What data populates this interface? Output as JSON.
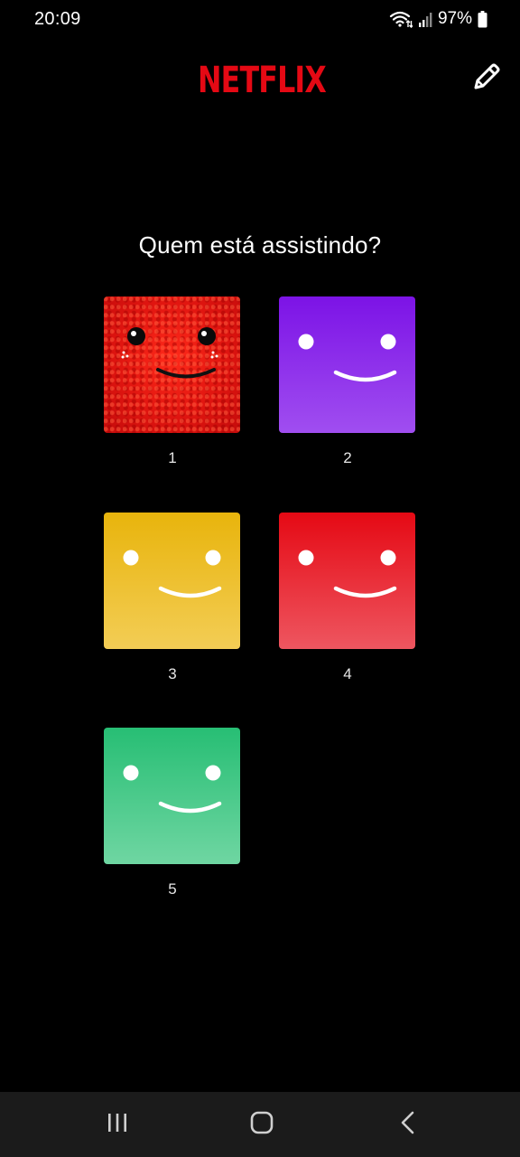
{
  "status_bar": {
    "time": "20:09",
    "battery": "97%",
    "icons": [
      "wifi-icon",
      "signal-icon",
      "battery-icon"
    ]
  },
  "header": {
    "logo": "NETFLIX",
    "edit_icon": "pencil-icon"
  },
  "heading": "Quem está assistindo?",
  "profiles": [
    {
      "name": "1",
      "avatar": "red-fur-smiley"
    },
    {
      "name": "2",
      "avatar": "purple-smiley"
    },
    {
      "name": "3",
      "avatar": "yellow-smiley"
    },
    {
      "name": "4",
      "avatar": "red-smiley"
    },
    {
      "name": "5",
      "avatar": "green-smiley"
    }
  ],
  "nav_bar": {
    "buttons": [
      "recent-apps-icon",
      "home-icon",
      "back-icon"
    ]
  },
  "colors": {
    "brand": "#e50914",
    "background": "#000000",
    "purple": "#7c13e6",
    "yellow": "#e8b40c",
    "red": "#e50914",
    "green": "#27be74"
  }
}
